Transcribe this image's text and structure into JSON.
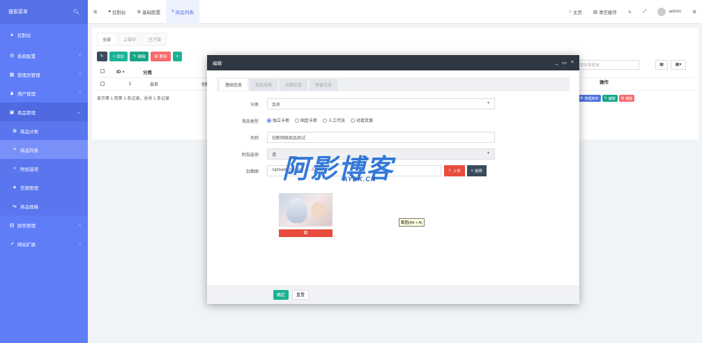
{
  "sidebar": {
    "search": "搜索菜单",
    "items": [
      {
        "label": "控制台",
        "icon": "dashboard-icon"
      },
      {
        "label": "系统配置",
        "icon": "gears-icon"
      },
      {
        "label": "管理员管理",
        "icon": "list-icon"
      },
      {
        "label": "用户管理",
        "icon": "user-icon"
      },
      {
        "label": "商品管理",
        "icon": "cart-icon"
      },
      {
        "label": "商品分类",
        "icon": "leaf-icon"
      },
      {
        "label": "商品列表",
        "icon": "list-icon"
      },
      {
        "label": "附加选项",
        "icon": "chevron-icon"
      },
      {
        "label": "货源管理",
        "icon": "sitemap-icon"
      },
      {
        "label": "商品规格",
        "icon": "sliders-icon"
      },
      {
        "label": "财务管理",
        "icon": "money-icon"
      },
      {
        "label": "网站扩展",
        "icon": "external-icon"
      }
    ]
  },
  "topbar": {
    "tabs": [
      {
        "label": "控制台"
      },
      {
        "label": "基础配置"
      },
      {
        "label": "商品列表"
      }
    ],
    "right": {
      "home": "主页",
      "clear": "清空缓存",
      "user": "admin"
    }
  },
  "main": {
    "tabs": [
      "全部",
      "上架中",
      "已下架"
    ],
    "toolbar": {
      "add": "添加",
      "edit": "编辑",
      "del": "删除"
    },
    "search_placeholder": "类名称查询",
    "table": {
      "headers": [
        "ID",
        "分类",
        "操作"
      ],
      "rows": [
        {
          "id": "1",
          "cat": "会员",
          "name": "创新"
        }
      ]
    },
    "row_actions": [
      "管理库存",
      "编辑",
      "删除"
    ],
    "pager": "显示第 1 到第 1 条记录，总共 1 条记录"
  },
  "modal": {
    "title": "编辑",
    "tabs": [
      "基础信息",
      "商品规格",
      "详细信息",
      "弹窗信息"
    ],
    "fields": {
      "category_label": "分类",
      "category_value": "会员",
      "type_label": "商品类型",
      "types": [
        "独立卡密",
        "固定卡密",
        "人工代充",
        "对接货源"
      ],
      "name_label": "名称",
      "name_value": "创新网络商品测试",
      "extra_label": "附加选项",
      "extra_value": "请",
      "cover_label": "封面图",
      "cover_value": "/uploads/20…04…/…07823…"
    },
    "upload": "上传",
    "choose": "选择",
    "tooltip": "截图(Alt + A)",
    "ok": "确定",
    "reset": "重置"
  },
  "watermark": {
    "main": "阿影博客",
    "sub": "AYBK.CN"
  }
}
